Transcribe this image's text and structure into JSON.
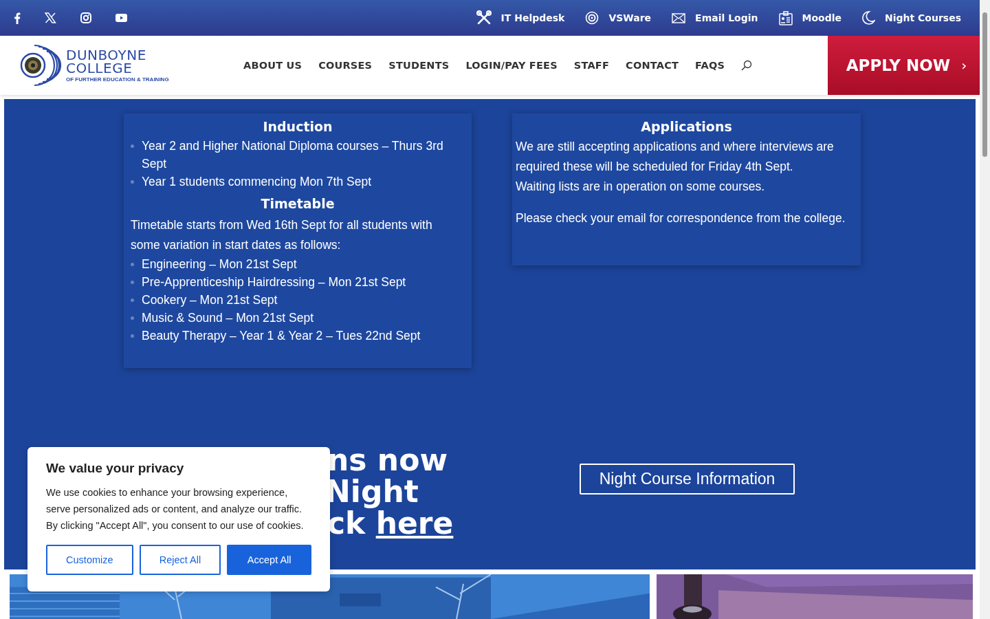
{
  "social_links": [
    {
      "kind": "facebook"
    },
    {
      "kind": "x"
    },
    {
      "kind": "instagram"
    },
    {
      "kind": "youtube"
    }
  ],
  "quick_links": [
    {
      "kind": "tools",
      "label": "IT Helpdesk"
    },
    {
      "kind": "target",
      "label": "VSWare"
    },
    {
      "kind": "mail",
      "label": "Email Login"
    },
    {
      "kind": "badge",
      "label": "Moodle"
    },
    {
      "kind": "moon",
      "label": "Night Courses"
    }
  ],
  "logo": {
    "name": "DUNBOYNE",
    "name_2": "COLLEGE",
    "tagline": "OF FURTHER EDUCATION & TRAINING"
  },
  "nav": [
    "ABOUT US",
    "COURSES",
    "STUDENTS",
    "LOGIN/PAY FEES",
    "STAFF",
    "CONTACT",
    "FAQS"
  ],
  "apply_button": {
    "label": "APPLY NOW",
    "arrow": "›"
  },
  "induction": {
    "title": "Induction",
    "items": [
      "Year 2 and Higher National Diploma courses – Thurs 3rd Sept",
      "Year 1 students commencing Mon 7th Sept"
    ]
  },
  "timetable": {
    "title": "Timetable",
    "intro": "Timetable starts from Wed 16th  Sept for all students with some variation in start dates as follows:",
    "items": [
      "Engineering – Mon 21st Sept",
      "Pre-Apprenticeship Hairdressing – Mon 21st Sept",
      "Cookery – Mon 21st Sept",
      "Music & Sound – Mon 21st Sept",
      "Beauty Therapy – Year 1 & Year 2 – Tues 22nd Sept"
    ]
  },
  "applications": {
    "title": "Applications",
    "paragraphs": [
      "We are still accepting applications and where interviews are required these will be scheduled for Friday 4th Sept.",
      "Waiting lists are in operation on some courses.",
      "Please check your email for correspondence from the college."
    ]
  },
  "night_heading": {
    "lines": [
      "ns now",
      "Night",
      "ck"
    ],
    "link": "here"
  },
  "night_button": "Night Course Information",
  "cookie_banner": {
    "title": "We value your privacy",
    "text": "We use cookies to enhance your browsing experience, serve personalized ads or content, and analyze our traffic. By clicking \"Accept All\", you consent to our use of cookies.",
    "buttons": [
      {
        "label": "Customize",
        "kind": "outline"
      },
      {
        "label": "Reject All",
        "kind": "outline"
      },
      {
        "label": "Accept All",
        "kind": "primary"
      }
    ]
  }
}
